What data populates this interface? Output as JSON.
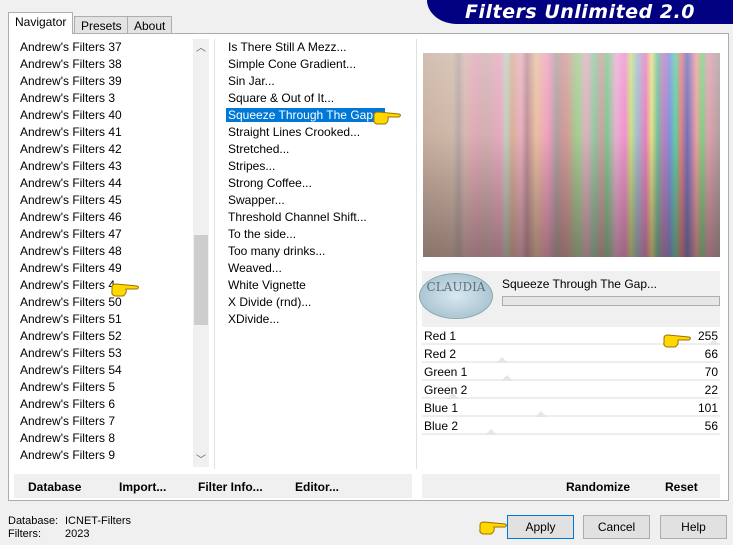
{
  "header": {
    "logo": "Filters Unlimited 2.0"
  },
  "tabs": [
    {
      "label": "Navigator",
      "active": true
    },
    {
      "label": "Presets"
    },
    {
      "label": "About"
    }
  ],
  "categories": {
    "items": [
      "Andrew's Filters 37",
      "Andrew's Filters 38",
      "Andrew's Filters 39",
      "Andrew's Filters 3",
      "Andrew's Filters 40",
      "Andrew's Filters 41",
      "Andrew's Filters 42",
      "Andrew's Filters 43",
      "Andrew's Filters 44",
      "Andrew's Filters 45",
      "Andrew's Filters 46",
      "Andrew's Filters 47",
      "Andrew's Filters 48",
      "Andrew's Filters 49",
      "Andrew's Filters 4",
      "Andrew's Filters 50",
      "Andrew's Filters 51",
      "Andrew's Filters 52",
      "Andrew's Filters 53",
      "Andrew's Filters 54",
      "Andrew's Filters 5",
      "Andrew's Filters 6",
      "Andrew's Filters 7",
      "Andrew's Filters 8",
      "Andrew's Filters 9"
    ],
    "selected": "Andrew's Filters 4"
  },
  "filters": {
    "items": [
      "Is There Still A Mezz...",
      "Simple Cone Gradient...",
      "Sin Jar...",
      "Square & Out of It...",
      "Squeeze Through The Gap...",
      "Straight Lines Crooked...",
      "Stretched...",
      "Stripes...",
      "Strong Coffee...",
      "Swapper...",
      "Threshold Channel Shift...",
      "To the side...",
      "Too many drinks...",
      "Weaved...",
      "White Vignette",
      "X Divide (rnd)...",
      "XDivide..."
    ],
    "selected": "Squeeze Through The Gap..."
  },
  "preview": {
    "filter_name": "Squeeze Through The Gap...",
    "watermark": "CLAUDIA"
  },
  "params": [
    {
      "label": "Red 1",
      "value": 255
    },
    {
      "label": "Red 2",
      "value": 66
    },
    {
      "label": "Green 1",
      "value": 70
    },
    {
      "label": "Green 2",
      "value": 22
    },
    {
      "label": "Blue 1",
      "value": 101
    },
    {
      "label": "Blue 2",
      "value": 56
    }
  ],
  "toolbar": {
    "database": "Database",
    "import": "Import...",
    "filter_info": "Filter Info...",
    "editor": "Editor...",
    "randomize": "Randomize",
    "reset": "Reset"
  },
  "status": {
    "database_label": "Database:",
    "database_value": "ICNET-Filters",
    "filters_label": "Filters:",
    "filters_value": "2023"
  },
  "buttons": {
    "apply": "Apply",
    "cancel": "Cancel",
    "help": "Help"
  },
  "colors": {
    "selection": "#0078d7",
    "logo_bg": "#000080",
    "hand": "#ffd800"
  }
}
